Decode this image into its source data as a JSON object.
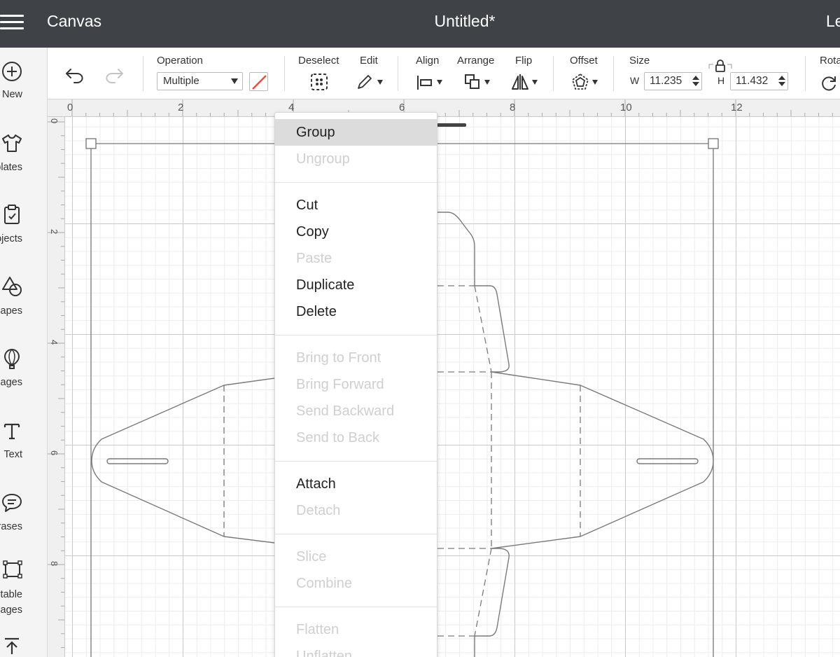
{
  "header": {
    "app_title": "Canvas",
    "doc_title": "Untitled*",
    "right_link": "Le"
  },
  "sidebar": {
    "items": [
      {
        "label": "New",
        "icon": "plus-circle-icon"
      },
      {
        "label": "mplates",
        "icon": "tshirt-icon"
      },
      {
        "label": "rojects",
        "icon": "clipboard-icon"
      },
      {
        "label": "hapes",
        "icon": "shapes-icon"
      },
      {
        "label": "mages",
        "icon": "balloon-icon"
      },
      {
        "label": "Text",
        "icon": "text-t-icon"
      },
      {
        "label": "hrases",
        "icon": "speech-bubble-icon"
      },
      {
        "label": "ditable",
        "label2": "mages",
        "icon": "editable-image-icon"
      },
      {
        "label": "",
        "icon": "upload-icon"
      }
    ]
  },
  "toolbar": {
    "operation_label": "Operation",
    "operation_value": "Multiple",
    "deselect_label": "Deselect",
    "edit_label": "Edit",
    "align_label": "Align",
    "arrange_label": "Arrange",
    "flip_label": "Flip",
    "offset_label": "Offset",
    "size_label": "Size",
    "width_prefix": "W",
    "width_value": "11.235",
    "height_prefix": "H",
    "height_value": "11.432",
    "rotate_label": "Rota",
    "accent_color": "#e2553d"
  },
  "rulers": {
    "horizontal": [
      "0",
      "2",
      "4",
      "6",
      "8",
      "10",
      "12"
    ],
    "vertical": [
      "0",
      "2",
      "4",
      "6",
      "8"
    ]
  },
  "context_menu": {
    "items": [
      {
        "label": "Group",
        "enabled": true,
        "highlighted": true
      },
      {
        "label": "Ungroup",
        "enabled": false
      },
      {
        "label": "Cut",
        "enabled": true
      },
      {
        "label": "Copy",
        "enabled": true
      },
      {
        "label": "Paste",
        "enabled": false
      },
      {
        "label": "Duplicate",
        "enabled": true
      },
      {
        "label": "Delete",
        "enabled": true
      },
      {
        "label": "Bring to Front",
        "enabled": false
      },
      {
        "label": "Bring Forward",
        "enabled": false
      },
      {
        "label": "Send Backward",
        "enabled": false
      },
      {
        "label": "Send to Back",
        "enabled": false
      },
      {
        "label": "Attach",
        "enabled": true
      },
      {
        "label": "Detach",
        "enabled": false
      },
      {
        "label": "Slice",
        "enabled": false
      },
      {
        "label": "Combine",
        "enabled": false
      },
      {
        "label": "Flatten",
        "enabled": false
      },
      {
        "label": "Unflatten",
        "enabled": false
      }
    ]
  }
}
